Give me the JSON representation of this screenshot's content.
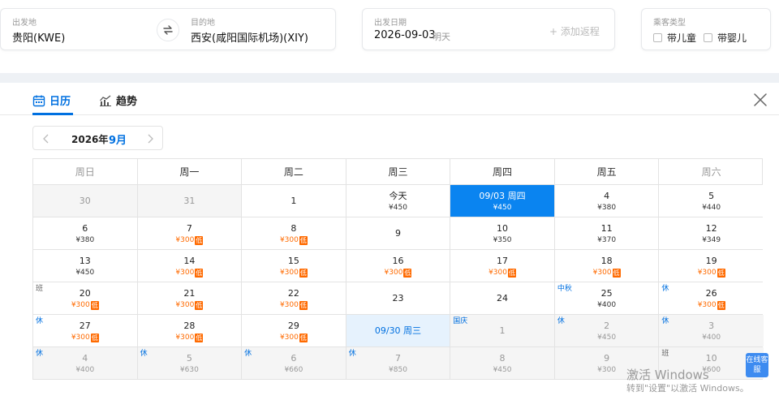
{
  "search": {
    "from_label": "出发地",
    "from_value": "贵阳(KWE)",
    "to_label": "目的地",
    "to_value": "西安(咸阳国际机场)(XIY)",
    "date_label": "出发日期",
    "date_value": "2026-09-03",
    "date_hint": "明天",
    "add_return": "+ 添加返程",
    "pax_label": "乘客类型",
    "child_label": "带儿童",
    "infant_label": "带婴儿"
  },
  "panel": {
    "tab_calendar": "日历",
    "tab_trend": "趋势",
    "year": "2026年",
    "month": "9月"
  },
  "calendar": {
    "weekdays": [
      "周日",
      "周一",
      "周二",
      "周三",
      "周四",
      "周五",
      "周六"
    ],
    "weeks": [
      [
        {
          "day": "30",
          "other": true
        },
        {
          "day": "31",
          "other": true
        },
        {
          "day": "1"
        },
        {
          "day": "今天",
          "price": "¥450"
        },
        {
          "day": "09/03 周四",
          "price": "¥450",
          "selected": true
        },
        {
          "day": "4",
          "price": "¥380"
        },
        {
          "day": "5",
          "price": "¥440"
        }
      ],
      [
        {
          "day": "6",
          "price": "¥380"
        },
        {
          "day": "7",
          "price": "¥300",
          "low": true
        },
        {
          "day": "8",
          "price": "¥300",
          "low": true
        },
        {
          "day": "9"
        },
        {
          "day": "10",
          "price": "¥350"
        },
        {
          "day": "11",
          "price": "¥370"
        },
        {
          "day": "12",
          "price": "¥349"
        }
      ],
      [
        {
          "day": "13",
          "price": "¥450"
        },
        {
          "day": "14",
          "price": "¥300",
          "low": true
        },
        {
          "day": "15",
          "price": "¥300",
          "low": true
        },
        {
          "day": "16",
          "price": "¥300",
          "low": true
        },
        {
          "day": "17",
          "price": "¥300",
          "low": true
        },
        {
          "day": "18",
          "price": "¥300",
          "low": true
        },
        {
          "day": "19",
          "price": "¥300",
          "low": true
        }
      ],
      [
        {
          "day": "20",
          "price": "¥300",
          "low": true,
          "tag": "班"
        },
        {
          "day": "21",
          "price": "¥300",
          "low": true
        },
        {
          "day": "22",
          "price": "¥300",
          "low": true
        },
        {
          "day": "23"
        },
        {
          "day": "24"
        },
        {
          "day": "25",
          "price": "¥400",
          "tag": "中秋"
        },
        {
          "day": "26",
          "price": "¥300",
          "low": true,
          "tag": "休"
        }
      ],
      [
        {
          "day": "27",
          "price": "¥300",
          "low": true,
          "tag": "休"
        },
        {
          "day": "28",
          "price": "¥300",
          "low": true
        },
        {
          "day": "29",
          "price": "¥300",
          "low": true
        },
        {
          "day": "09/30 周三",
          "ret": true
        },
        {
          "day": "1",
          "other": true,
          "tag": "国庆"
        },
        {
          "day": "2",
          "price": "¥450",
          "other": true,
          "tag": "休"
        },
        {
          "day": "3",
          "price": "¥400",
          "other": true,
          "tag": "休"
        }
      ],
      [
        {
          "day": "4",
          "price": "¥400",
          "other": true,
          "tag": "休"
        },
        {
          "day": "5",
          "price": "¥630",
          "other": true,
          "tag": "休"
        },
        {
          "day": "6",
          "price": "¥660",
          "other": true,
          "tag": "休"
        },
        {
          "day": "7",
          "price": "¥850",
          "other": true,
          "tag": "休"
        },
        {
          "day": "8",
          "price": "¥450",
          "other": true
        },
        {
          "day": "9",
          "price": "¥300",
          "other": true
        },
        {
          "day": "10",
          "price": "¥600",
          "other": true,
          "tag": "班"
        }
      ]
    ],
    "low_badge": "低"
  },
  "overlay": {
    "online_service": "在线客服",
    "win_line1": "激活 Windows",
    "win_line2": "转到\"设置\"以激活 Windows。"
  },
  "colors": {
    "accent": "#0070e0",
    "selected_bg": "#0a84f0",
    "low_price": "#ff6a00"
  }
}
